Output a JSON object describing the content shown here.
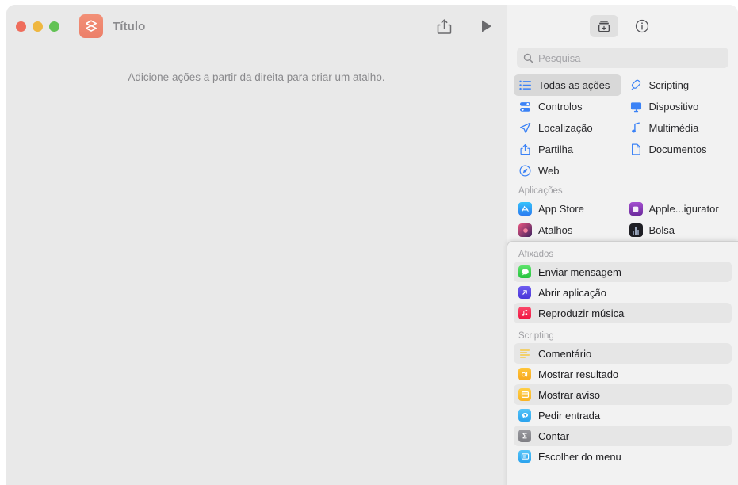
{
  "window": {
    "title": "Título",
    "app_icon_name": "shortcuts-app-icon",
    "traffic_lights": [
      {
        "name": "close-button",
        "color": "#ef6d5c"
      },
      {
        "name": "minimize-button",
        "color": "#efb740"
      },
      {
        "name": "zoom-button",
        "color": "#62c254"
      }
    ]
  },
  "toolbar": {
    "share_label": "share-icon",
    "run_label": "play-icon"
  },
  "canvas": {
    "empty_message": "Adicione ações a partir da direita para criar um atalho."
  },
  "inspector": {
    "buttons": [
      {
        "name": "action-library-button",
        "icon": "library-add-icon",
        "active": true
      },
      {
        "name": "shortcut-details-button",
        "icon": "info-circle-icon",
        "active": false
      }
    ],
    "search": {
      "placeholder": "Pesquisa",
      "value": "",
      "icon": "search-icon"
    },
    "categories": [
      {
        "label": "Todas as ações",
        "icon": "list-icon",
        "selected": true,
        "color": "#3b82f6"
      },
      {
        "label": "Scripting",
        "icon": "pen-nib-icon",
        "selected": false,
        "color": "#3b82f6"
      },
      {
        "label": "Controlos",
        "icon": "sliders-icon",
        "selected": false,
        "color": "#3b82f6"
      },
      {
        "label": "Dispositivo",
        "icon": "monitor-icon",
        "selected": false,
        "color": "#3b82f6"
      },
      {
        "label": "Localização",
        "icon": "paper-plane-icon",
        "selected": false,
        "color": "#3b82f6"
      },
      {
        "label": "Multimédia",
        "icon": "music-note-icon",
        "selected": false,
        "color": "#3b82f6"
      },
      {
        "label": "Partilha",
        "icon": "share-icon",
        "selected": false,
        "color": "#3b82f6"
      },
      {
        "label": "Documentos",
        "icon": "document-icon",
        "selected": false,
        "color": "#3b82f6"
      },
      {
        "label": "Web",
        "icon": "compass-icon",
        "selected": false,
        "color": "#3b82f6"
      }
    ],
    "apps_header": "Aplicações",
    "apps": [
      {
        "label": "App Store",
        "icon": "app-store-icon",
        "color": "#2a9df4"
      },
      {
        "label": "Apple...igurator",
        "icon": "apple-configurator-icon",
        "color": "#8b3fb5"
      },
      {
        "label": "Atalhos",
        "icon": "shortcuts-icon",
        "color": "#3b2a52"
      },
      {
        "label": "Bolsa",
        "icon": "stocks-icon",
        "color": "#2b2b30"
      }
    ]
  },
  "overlay": {
    "pinned_header": "Afixados",
    "pinned": [
      {
        "label": "Enviar mensagem",
        "icon": "messages-icon",
        "color": "#4ad963",
        "highlight": true
      },
      {
        "label": "Abrir aplicação",
        "icon": "open-app-icon",
        "color": "#5a4ae0",
        "highlight": false
      },
      {
        "label": "Reproduzir música",
        "icon": "music-play-icon",
        "color": "#fa2b56",
        "highlight": true
      }
    ],
    "scripting_header": "Scripting",
    "scripting": [
      {
        "label": "Comentário",
        "icon": "comment-icon",
        "color": "#ffcc33",
        "highlight": true
      },
      {
        "label": "Mostrar resultado",
        "icon": "show-result-icon",
        "color": "#ffb52e",
        "highlight": false
      },
      {
        "label": "Mostrar aviso",
        "icon": "show-alert-icon",
        "color": "#ffc52e",
        "highlight": true
      },
      {
        "label": "Pedir entrada",
        "icon": "ask-input-icon",
        "color": "#42b6f5",
        "highlight": false
      },
      {
        "label": "Contar",
        "icon": "count-sigma-icon",
        "color": "#8e8e93",
        "highlight": true
      },
      {
        "label": "Escolher do menu",
        "icon": "choose-menu-icon",
        "color": "#42b6f5",
        "highlight": false
      }
    ]
  }
}
